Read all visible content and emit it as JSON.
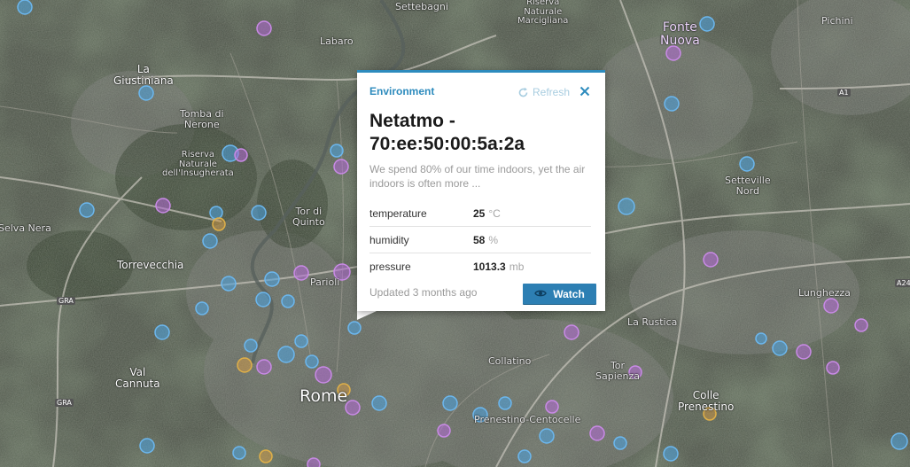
{
  "popup": {
    "category": "Environment",
    "refresh_label": "Refresh",
    "title": "Netatmo - 70:ee:50:00:5a:2a",
    "description": "We spend 80% of our time indoors, yet the air indoors is often more ...",
    "readings": [
      {
        "name": "temperature",
        "value": "25",
        "unit": "°C"
      },
      {
        "name": "humidity",
        "value": "58",
        "unit": "%"
      },
      {
        "name": "pressure",
        "value": "1013.3",
        "unit": "mb"
      }
    ],
    "updated": "Updated 3 months ago",
    "watch_label": "Watch"
  },
  "map": {
    "places": {
      "settebagni": "Settebagni",
      "fonte_nuova": "Fonte\nNuova",
      "pichini": "Pichini",
      "la_giustiniana": "La\nGiustiniana",
      "labaro": "Labaro",
      "tomba_di_nerone": "Tomba di\nNerone",
      "riserva": "Riserva\nNaturale\ndell'Insugherata",
      "tor_di_quinto": "Tor di\nQuinto",
      "selva_nera": "Selva Nera",
      "torrevecchia": "Torrevecchia",
      "parioli": "Parioli",
      "setteville_nord": "Setteville\nNord",
      "lunghezza": "Lunghezza",
      "la_rustica": "La Rustica",
      "collatino": "Collatino",
      "tor_sapienza": "Tor\nSapienza",
      "val_cannuta": "Val\nCannuta",
      "rome": "Rome",
      "prenestino_centocelle": "Prenestino-Centocelle",
      "colle_prenestino": "Colle\nPrenestino",
      "marcigliana": "Riserva\nNaturale\nMarcigliana"
    },
    "shields": [
      "A1",
      "GRA",
      "GRA",
      "A24"
    ],
    "colors": {
      "marker_blue": "#4aa3e0",
      "marker_purple": "#b36ad6",
      "marker_orange": "#e0a040",
      "accent": "#2d8bbd"
    }
  }
}
